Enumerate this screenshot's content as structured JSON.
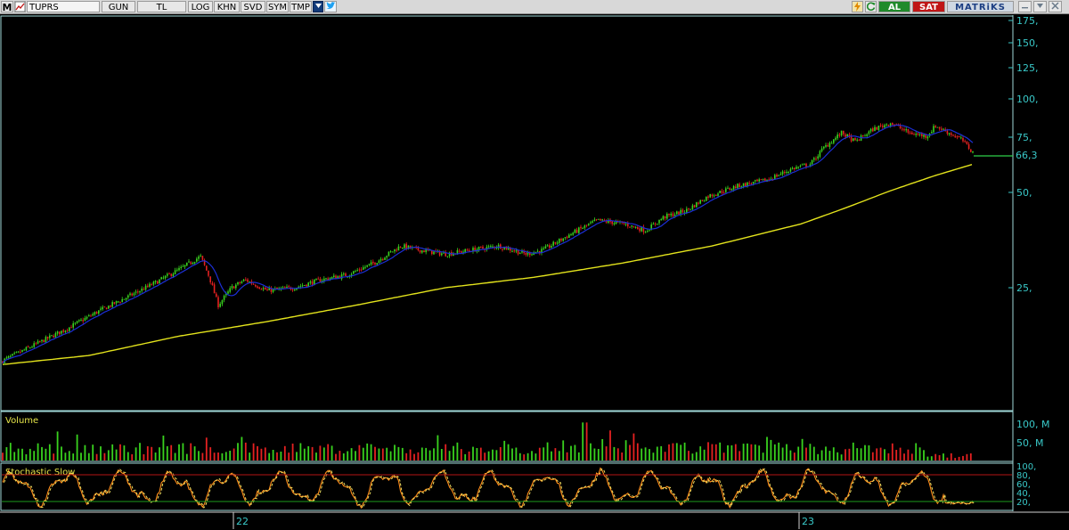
{
  "toolbar": {
    "menu_label": "M",
    "symbol": "TUPRS",
    "period": "GUN",
    "currency": "TL",
    "buttons": [
      "LOG",
      "KHN",
      "SVD",
      "SYM",
      "TMP"
    ],
    "al_label": "AL",
    "sat_label": "SAT",
    "brand": "MATRiKS",
    "icons": [
      "menu-icon",
      "chart-type-icon",
      "dropdown-icon",
      "twitter-icon",
      "lightning-icon",
      "refresh-icon",
      "minimize-icon",
      "restore-icon",
      "close-icon"
    ]
  },
  "price_axis": {
    "ticks": [
      "175,",
      "150,",
      "125,",
      "100,",
      "75,",
      "50,",
      "25,"
    ],
    "last_price": "66,3"
  },
  "volume_panel": {
    "label": "Volume",
    "ticks": [
      "100, M",
      "50, M"
    ]
  },
  "stoch_panel": {
    "label": "Stochastic Slow",
    "ticks": [
      "100,",
      "80,",
      "60,",
      "40,",
      "20,"
    ]
  },
  "time_axis": {
    "labels": [
      "22",
      "23"
    ]
  },
  "colors": {
    "background": "#000000",
    "up_candle": "#39d21e",
    "down_candle": "#e52121",
    "ma_short": "#1c2fd6",
    "ma_long": "#e3e31c",
    "last_price_line": "#2fcf4a",
    "axis_text": "#39c9c9",
    "stoch_line": "#ff8c1a",
    "stoch_dash": "#f0e060"
  },
  "chart_data": {
    "type": "candlestick",
    "scale": "log",
    "x_axis_labels": [
      "22",
      "23"
    ],
    "y_ticks": [
      175,
      150,
      125,
      100,
      75,
      50,
      25
    ],
    "last_price": 66.3,
    "trend_anchors": [
      [
        0,
        14.5
      ],
      [
        15,
        15.2
      ],
      [
        40,
        16.5
      ],
      [
        75,
        18.5
      ],
      [
        110,
        21
      ],
      [
        145,
        23.5
      ],
      [
        175,
        26
      ],
      [
        205,
        29
      ],
      [
        225,
        31.5
      ],
      [
        235,
        27
      ],
      [
        245,
        22
      ],
      [
        260,
        25
      ],
      [
        275,
        26.5
      ],
      [
        300,
        24.5
      ],
      [
        330,
        25
      ],
      [
        360,
        26.5
      ],
      [
        390,
        27.5
      ],
      [
        420,
        30
      ],
      [
        450,
        34
      ],
      [
        470,
        33
      ],
      [
        500,
        32
      ],
      [
        530,
        33
      ],
      [
        560,
        34
      ],
      [
        590,
        32
      ],
      [
        610,
        33
      ],
      [
        640,
        37
      ],
      [
        670,
        41
      ],
      [
        700,
        40
      ],
      [
        725,
        38
      ],
      [
        745,
        42
      ],
      [
        770,
        44
      ],
      [
        795,
        49
      ],
      [
        830,
        53
      ],
      [
        860,
        55
      ],
      [
        890,
        60
      ],
      [
        910,
        62
      ],
      [
        925,
        70
      ],
      [
        945,
        78
      ],
      [
        960,
        73
      ],
      [
        980,
        80
      ],
      [
        1000,
        84
      ],
      [
        1020,
        78
      ],
      [
        1040,
        76
      ],
      [
        1050,
        82
      ],
      [
        1065,
        78
      ],
      [
        1080,
        74
      ],
      [
        1093,
        67
      ]
    ],
    "ma_long_anchors": [
      [
        0,
        14.2
      ],
      [
        100,
        15.2
      ],
      [
        200,
        17.5
      ],
      [
        300,
        19.5
      ],
      [
        400,
        22
      ],
      [
        500,
        25
      ],
      [
        600,
        27
      ],
      [
        700,
        30
      ],
      [
        800,
        34
      ],
      [
        900,
        40
      ],
      [
        950,
        45
      ],
      [
        1000,
        51
      ],
      [
        1050,
        57
      ],
      [
        1093,
        62
      ]
    ],
    "volume_range_millions": [
      0,
      120
    ],
    "stochastic": {
      "levels": [
        80,
        20
      ],
      "range": [
        0,
        100
      ]
    }
  }
}
